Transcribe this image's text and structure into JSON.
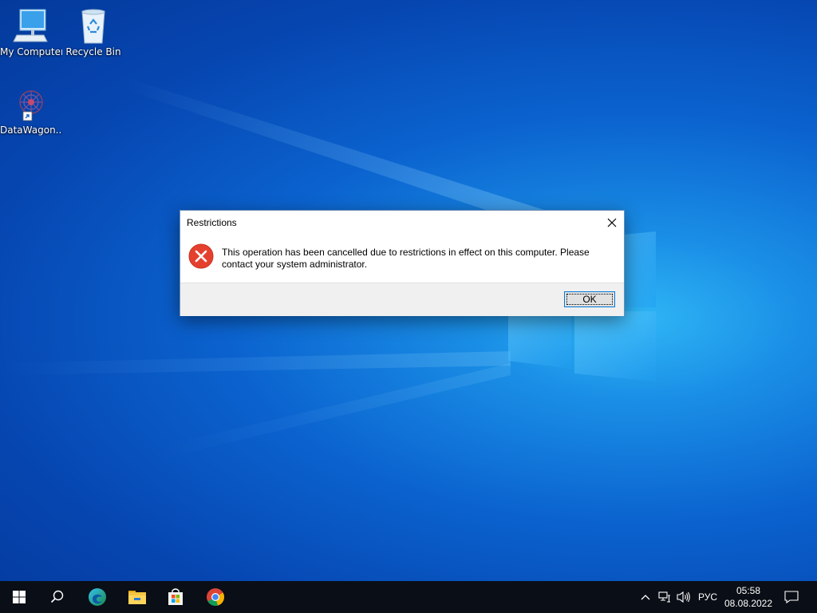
{
  "desktop": {
    "icons": [
      {
        "label": "My Computer",
        "icon": "computer-icon"
      },
      {
        "label": "Recycle Bin",
        "icon": "recycle-bin-icon"
      },
      {
        "label": "DataWagon...",
        "icon": "datawagon-shortcut-icon"
      }
    ]
  },
  "dialog": {
    "title": "Restrictions",
    "message": "This operation has been cancelled due to restrictions in effect on this computer. Please contact your system administrator.",
    "ok_label": "OK",
    "icon": "error-icon"
  },
  "taskbar": {
    "pinned": [
      "start-icon",
      "search-icon",
      "edge-icon",
      "file-explorer-icon",
      "store-icon",
      "chrome-icon"
    ],
    "tray": {
      "language": "РУС",
      "time": "05:58",
      "date": "08.08.2022"
    }
  },
  "colors": {
    "taskbar": "#0a0e16",
    "error": "#e81123",
    "accent": "#0078d7"
  }
}
